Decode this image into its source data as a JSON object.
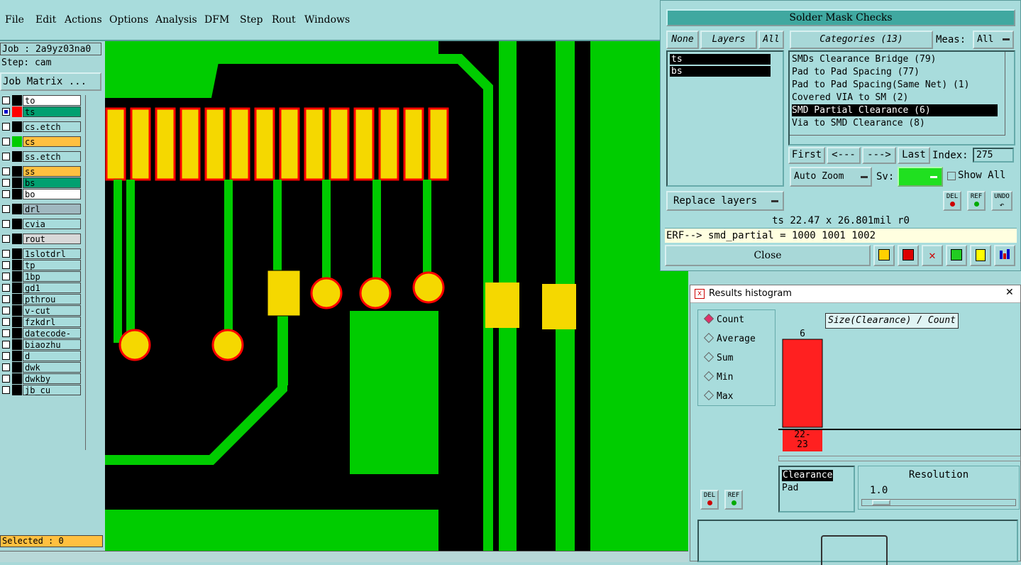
{
  "menubar": {
    "items": [
      "File",
      "Edit",
      "Actions",
      "Options",
      "Analysis",
      "DFM",
      "Step",
      "Rout",
      "Windows"
    ]
  },
  "job": {
    "job_label": "Job : 2a9yz03na0",
    "step_label": "Step: cam",
    "matrix_button": "Job Matrix ..."
  },
  "layers": [
    {
      "name": "to",
      "swatch": "#000000",
      "bg": "#ffffff",
      "checked": false
    },
    {
      "name": "ts",
      "swatch": "#ff0000",
      "bg": "#00a070",
      "checked": true
    },
    {
      "name": "cs.etch",
      "swatch": "#000000",
      "bg": "#a8dcdc",
      "checked": false
    },
    {
      "name": "cs",
      "swatch": "#00cc00",
      "bg": "#ffc040",
      "checked": false
    },
    {
      "name": "ss.etch",
      "swatch": "#000000",
      "bg": "#a8dcdc",
      "checked": false
    },
    {
      "name": "ss",
      "swatch": "#000000",
      "bg": "#ffc040",
      "checked": false
    },
    {
      "name": "bs",
      "swatch": "#000000",
      "bg": "#00a070",
      "checked": false
    },
    {
      "name": "bo",
      "swatch": "#000000",
      "bg": "#ffffff",
      "checked": false
    },
    {
      "name": "drl",
      "swatch": "#000000",
      "bg": "#a0b8c0",
      "checked": false
    },
    {
      "name": "cvia",
      "swatch": "#000000",
      "bg": "#a8dcdc",
      "checked": false
    },
    {
      "name": "rout",
      "swatch": "#000000",
      "bg": "#d8d8d8",
      "checked": false
    },
    {
      "name": "1slotdrl",
      "swatch": "#000000",
      "bg": "#a8dcdc",
      "checked": false
    },
    {
      "name": "tp",
      "swatch": "#000000",
      "bg": "#a8dcdc",
      "checked": false
    },
    {
      "name": "1bp",
      "swatch": "#000000",
      "bg": "#a8dcdc",
      "checked": false
    },
    {
      "name": "gd1",
      "swatch": "#000000",
      "bg": "#a8dcdc",
      "checked": false
    },
    {
      "name": "pthrou",
      "swatch": "#000000",
      "bg": "#a8dcdc",
      "checked": false
    },
    {
      "name": "v-cut",
      "swatch": "#000000",
      "bg": "#a8dcdc",
      "checked": false
    },
    {
      "name": "fzkdrl",
      "swatch": "#000000",
      "bg": "#a8dcdc",
      "checked": false
    },
    {
      "name": "datecode-to",
      "swatch": "#000000",
      "bg": "#a8dcdc",
      "checked": false
    },
    {
      "name": "biaozhu",
      "swatch": "#000000",
      "bg": "#a8dcdc",
      "checked": false
    },
    {
      "name": "d",
      "swatch": "#000000",
      "bg": "#a8dcdc",
      "checked": false
    },
    {
      "name": "dwk",
      "swatch": "#000000",
      "bg": "#a8dcdc",
      "checked": false
    },
    {
      "name": "dwkby",
      "swatch": "#000000",
      "bg": "#a8dcdc",
      "checked": false
    },
    {
      "name": "jb_cu",
      "swatch": "#000000",
      "bg": "#a8dcdc",
      "checked": false
    }
  ],
  "selected_label": "Selected : 0",
  "smc": {
    "title": "Solder Mask Checks",
    "none_btn": "None",
    "layers_btn": "Layers",
    "all_btn": "All",
    "layer_list": [
      "ts",
      "bs"
    ],
    "categories_btn": "Categories (13)",
    "meas_label": "Meas:",
    "meas_value": "All",
    "categories": [
      "SMDs Clearance Bridge (79)",
      "Pad to Pad Spacing (77)",
      "Pad to Pad Spacing(Same Net) (1)",
      "Covered VIA to SM (2)",
      "SMD Partial Clearance (6)",
      "Via to SMD Clearance (8)"
    ],
    "selected_category_index": 4,
    "first_btn": "First",
    "prev_btn": "<---",
    "next_btn": "--->",
    "last_btn": "Last",
    "index_label": "Index:",
    "index_value": "275",
    "autozoom_btn": "Auto Zoom",
    "sv_label": "Sv:",
    "show_all_label": "Show All",
    "replace_btn": "Replace layers",
    "del_label": "DEL",
    "ref_label": "REF",
    "undo_label": "UNDO",
    "info_line": "ts 22.47 x 26.801mil  r0",
    "erf_line": "ERF--> smd_partial = 1000 1001 1002",
    "close_btn": "Close"
  },
  "histogram": {
    "window_title": "Results histogram",
    "close_x": "✕",
    "modes": [
      "Count",
      "Average",
      "Sum",
      "Min",
      "Max"
    ],
    "selected_mode": "Count",
    "chart_title": "Size(Clearance) / Count",
    "bar_count_label": "6",
    "bin_label": "22-\n23",
    "list_items": [
      "Clearance",
      "Pad"
    ],
    "resolution_label": "Resolution",
    "resolution_value": "1.0",
    "del_label": "DEL",
    "ref_label": "REF"
  },
  "chart_data": {
    "type": "bar",
    "title": "Size(Clearance) / Count",
    "categories": [
      "22-23"
    ],
    "values": [
      6
    ],
    "colors": {
      "bar": "#ff2020"
    }
  },
  "colors": {
    "board_green": "#00cc00",
    "copper_black": "#000000",
    "pad_yellow": "#f5d800",
    "mask_red": "#ff0000",
    "panel_bg": "#a8dcdc",
    "highlight": "#ffc040"
  }
}
